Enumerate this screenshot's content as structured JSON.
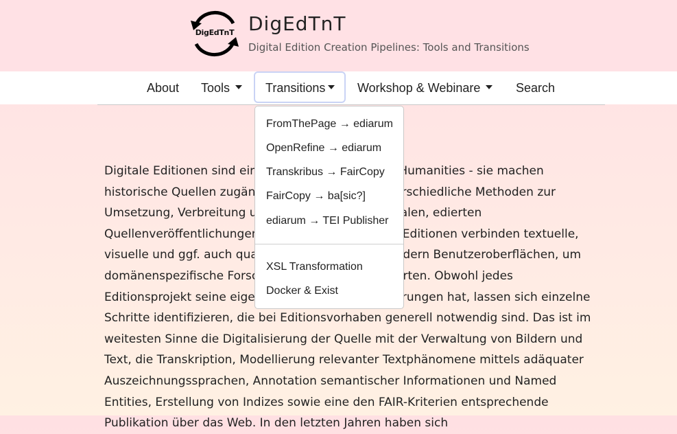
{
  "header": {
    "logo_text": "DigEdTnT",
    "title": "DigEdTnT",
    "subtitle": "Digital Edition Creation Pipelines: Tools and Transitions"
  },
  "nav": {
    "about": "About",
    "tools": "Tools",
    "transitions": "Transitions",
    "workshop": "Workshop & Webinare",
    "search": "Search"
  },
  "dropdown": {
    "items": [
      "FromThePage → ediarum",
      "OpenRefine → ediarum",
      "Transkribus → FairCopy",
      "FairCopy → ba[sic?]",
      "ediarum → TEI Publisher",
      "XSL Transformation",
      "Docker & Exist"
    ]
  },
  "content": {
    "paragraph": "Digitale Editionen sind ein Kernbereich der Digital Humanities - sie machen historische Quellen zugänglich. Dabei werden unterschiedliche Methoden zur Umsetzung, Verbreitung und Erforschung von digitalen, edierten Quellenveröffentlichungen herangezogen. Digitale Editionen verbinden textuelle, visuelle und ggf. auch quantitative Daten und erfordern Benutzeroberflächen, um domänenspezifische Forschungsfragen zu beantworten. Obwohl jedes Editionsprojekt seine eigenen spezifischen Anforderungen hat, lassen sich einzelne Schritte identifizieren, die bei Editionsvorhaben generell notwendig sind. Das ist im weitesten Sinne die Digitalisierung der Quelle mit der Verwaltung von Bildern und Text, die Transkription, Modellierung relevanter Textphänomene mittels adäquater Auszeichnungssprachen, Annotation semantischer Informationen und Named Entities, Erstellung von Indizes sowie eine den FAIR-Kriterien entsprechende Publikation über das Web. In den letzten Jahren haben sich"
  }
}
